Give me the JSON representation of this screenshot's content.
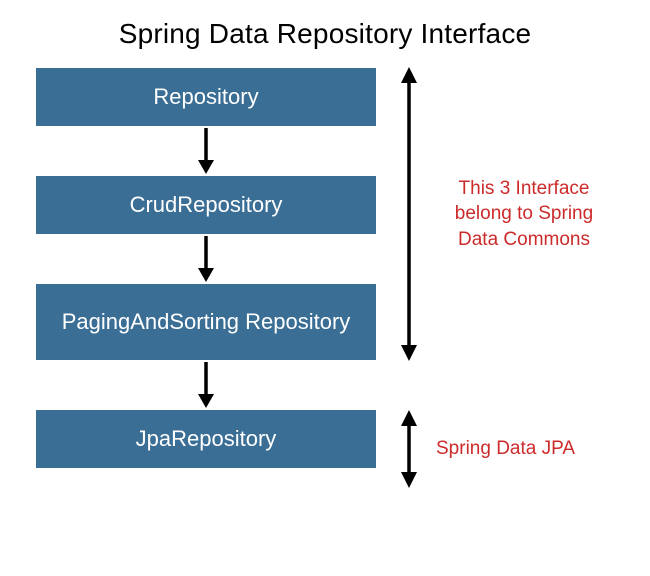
{
  "title": "Spring Data Repository Interface",
  "boxes": {
    "repository": "Repository",
    "crud": "CrudRepository",
    "paging": "PagingAndSorting Repository",
    "jpa": "JpaRepository"
  },
  "annotations": {
    "commons": "This 3 Interface belong to Spring Data Commons",
    "jpa": "Spring Data JPA"
  },
  "colors": {
    "box_bg": "#3a6e95",
    "box_text": "#ffffff",
    "annotation_text": "#cc2b2b",
    "title_text": "#000000"
  }
}
